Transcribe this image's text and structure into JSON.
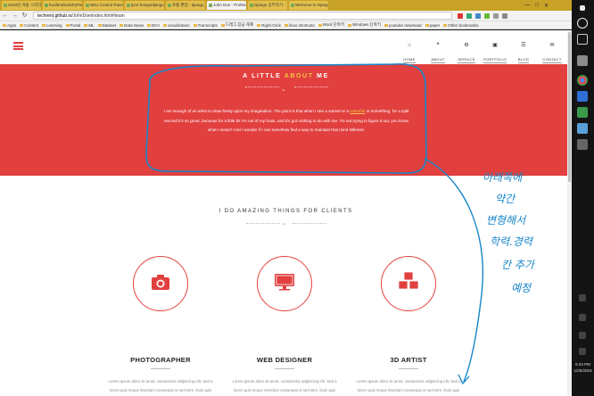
{
  "browser": {
    "tabs": [
      "2018년 겨울 스터디",
      "hoofen/DashPyFlaskm",
      "NEU Control Panel",
      "tjvm-hongs/django_",
      "포폴 편집 - django_",
      "John Doe - Professi",
      "Django 공부하기 - ",
      "Welcome to Django"
    ],
    "url_host": "techrent.github.io",
    "url_path": "/JohnDoe/index.html#team",
    "bookmarks": [
      "Apps",
      "Content",
      "Learning",
      "Portal",
      "ML",
      "Dataset",
      "Data News",
      "EKV",
      "visualization",
      "Transcripts",
      "드래그 잠금 해제",
      "Right-Click",
      "linux shortcuts",
      "Word 단축키",
      "Windows 단축키",
      "youtube download",
      "paper",
      "Other bookmarks"
    ],
    "window_controls": [
      "—",
      "□",
      "✕"
    ]
  },
  "site": {
    "nav": [
      {
        "label": "HOME",
        "icon": "home-icon",
        "glyph": "⌂"
      },
      {
        "label": "ABOUT",
        "icon": "quote-icon",
        "glyph": "❝"
      },
      {
        "label": "SERVICE",
        "icon": "gear-icon",
        "glyph": "⚙"
      },
      {
        "label": "PORTFOLIO",
        "icon": "image-icon",
        "glyph": "▣"
      },
      {
        "label": "BLOG",
        "icon": "list-icon",
        "glyph": "☰"
      },
      {
        "label": "CONTACT",
        "icon": "envelope-icon",
        "glyph": "✉"
      }
    ],
    "about": {
      "title_pre": "A LITTLE ",
      "title_accent": "ABOUT",
      "title_post": " ME",
      "text_1": "I am enough of an artist to draw freely upon my imagination. The point is that when I see a sunset or a ",
      "link": "waterfall",
      "text_2": " or something, for a split second it's so great, because for a little bit I'm out of my brain, and it's got nothing to do with me. I'm not trying to figure it out, you know what I mean? And I wonder if I can somehow find a way to maintain that mind stillness."
    },
    "services": {
      "title": "I DO AMAZING THINGS FOR CLIENTS",
      "items": [
        {
          "title": "PHOTOGRAPHER",
          "icon": "camera-icon"
        },
        {
          "title": "WEB DESIGNER",
          "icon": "monitor-icon"
        },
        {
          "title": "3D ARTIST",
          "icon": "cubes-icon"
        }
      ],
      "body": "Lorem ipsum dolor sit amet, consectetur adipiscing elit. Sed a lorem quis neque interdum consequat ut sed sem. Duis quis tempor nunc. Interdum et malesuada fames ac ante ipsum primis in faucibus."
    }
  },
  "annotation": {
    "lines": [
      "아래쪽에",
      "약간",
      "변형해서",
      "학력.경력",
      "칸 추가",
      "예정"
    ],
    "color": "#1786c8"
  },
  "taskbar": {
    "time": "6:44 PM",
    "date": "1/25/2019"
  },
  "colors": {
    "accent_red": "#e1403f",
    "accent_yellow": "#f6c544"
  }
}
